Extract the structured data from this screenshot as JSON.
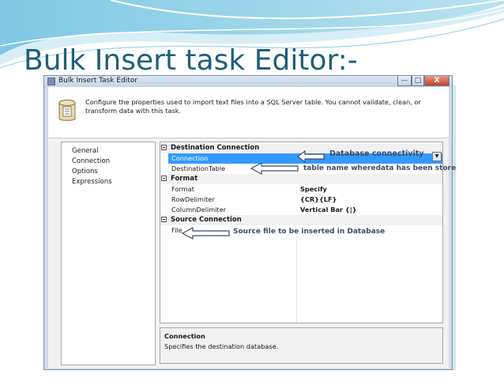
{
  "slide": {
    "title": "Bulk Insert task Editor:-"
  },
  "window": {
    "title": "Bulk Insert Task Editor",
    "minimize_glyph": "—",
    "maximize_glyph": "□",
    "close_glyph": "X",
    "header_text": "Configure the properties used to import text files into a SQL Server table. You cannot validate, clean, or transform data with this task."
  },
  "nav": {
    "items": [
      {
        "label": "General"
      },
      {
        "label": "Connection"
      },
      {
        "label": "Options"
      },
      {
        "label": "Expressions"
      }
    ]
  },
  "grid": {
    "categories": [
      {
        "label": "Destination Connection",
        "rows": [
          {
            "name": "Connection",
            "value": "",
            "selected": true
          },
          {
            "name": "DestinationTable",
            "value": ""
          }
        ]
      },
      {
        "label": "Format",
        "rows": [
          {
            "name": "Format",
            "value": "Specify"
          },
          {
            "name": "RowDelimiter",
            "value": "{CR}{LF}"
          },
          {
            "name": "ColumnDelimiter",
            "value": "Vertical Bar {|}"
          }
        ]
      },
      {
        "label": "Source Connection",
        "rows": [
          {
            "name": "File",
            "value": ""
          }
        ]
      }
    ]
  },
  "description": {
    "title": "Connection",
    "text": "Specifies the destination database."
  },
  "annotations": {
    "connection": "Database connectivity",
    "destination_table": "table name wheredata has been store",
    "file": "Source file to be inserted in Database"
  },
  "colors": {
    "title": "#1f5f7a",
    "selection": "#3399ff",
    "annotation": "#3d4b6b"
  }
}
